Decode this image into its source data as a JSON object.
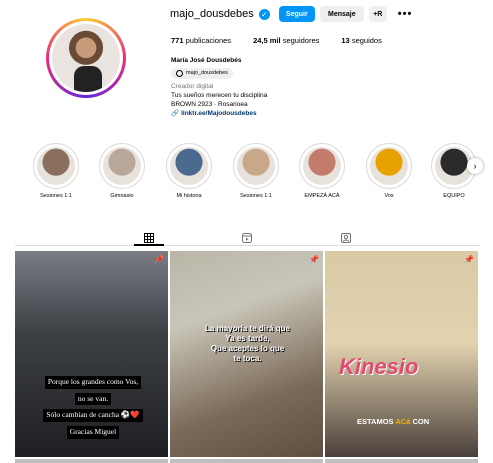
{
  "profile": {
    "username": "majo_dousdebes",
    "follow_label": "Seguir",
    "message_label": "Mensaje",
    "add_label": "+R",
    "more_label": "•••",
    "stats": {
      "posts_count": "771",
      "posts_label": "publicaciones",
      "followers_count": "24,5 mil",
      "followers_label": "seguidores",
      "following_count": "13",
      "following_label": "seguidos"
    },
    "full_name": "María José Dousdebés",
    "threads_handle": "majo_dousdebes",
    "category": "Creador digital",
    "bio_line1": "Tus sueños merecen tu disciplina",
    "bio_line2": "BROWN 2923 · Rosarioea",
    "link": "linktr.ee/Majodousdebes"
  },
  "highlights": [
    {
      "label": "Sesiones 1:1",
      "color": "#8a6e5e"
    },
    {
      "label": "Gimnasio",
      "color": "#b9a89a"
    },
    {
      "label": "Mi historia",
      "color": "#4b6a8f"
    },
    {
      "label": "Sesiones 1:1",
      "color": "#c9a88a"
    },
    {
      "label": "EMPEZÁ ACÁ",
      "color": "#c37c6b"
    },
    {
      "label": "Vos",
      "color": "#e8a200"
    },
    {
      "label": "EQUIPO",
      "color": "#2b2b2b"
    }
  ],
  "tabs": [
    {
      "name": "posts",
      "icon": "grid-icon"
    },
    {
      "name": "reels",
      "icon": "reels-icon"
    },
    {
      "name": "tagged",
      "icon": "tagged-icon"
    }
  ],
  "posts": [
    {
      "line1": "Porque los grandes como Vos,",
      "line2": "no se van.",
      "line3": "Sólo cambian de cancha ⚽❤️",
      "line4": "Gracias Miguel"
    },
    {
      "line1": "La mayoría te dirá que",
      "line2": "Ya es tarde,",
      "line3": "Que aceptes lo que",
      "line4": "te toca."
    },
    {
      "title": "Kinesio",
      "cap_a": "ESTAMOS",
      "cap_b": "ACá",
      "cap_c": "CON"
    }
  ]
}
